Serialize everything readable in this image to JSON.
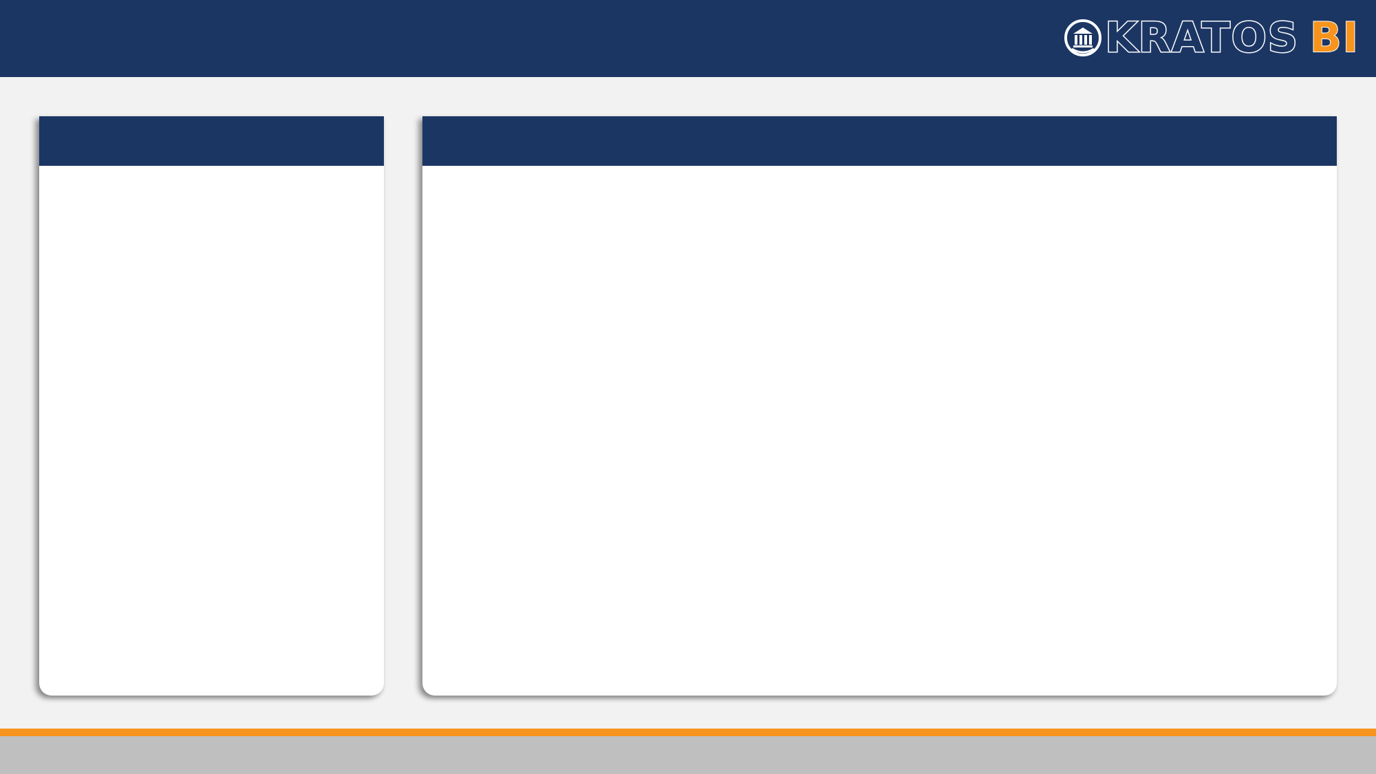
{
  "header": {
    "logo": {
      "icon": "temple-columns-icon",
      "wordmark": "KRATOS",
      "wordmark_accent": "BI"
    }
  },
  "panels": {
    "left": {
      "title": ""
    },
    "right": {
      "title": ""
    }
  },
  "colors": {
    "primary": "#1c3664",
    "accent": "#f7941d",
    "background": "#f2f2f2",
    "panel": "#ffffff",
    "footer": "#bfbfbf"
  }
}
